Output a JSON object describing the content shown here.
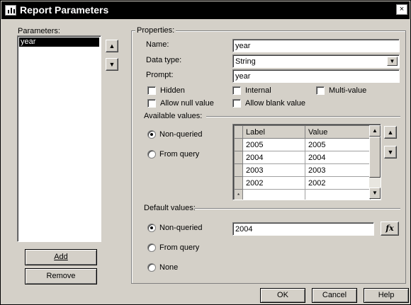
{
  "window": {
    "title": "Report Parameters",
    "close_glyph": "×"
  },
  "parameters_panel": {
    "label": "Parameters:",
    "items": [
      "year"
    ],
    "add_label": "Add",
    "remove_label": "Remove",
    "move_up_glyph": "▲",
    "move_down_glyph": "▼"
  },
  "properties": {
    "group_label": "Properties:",
    "name_label": "Name:",
    "name_value": "year",
    "datatype_label": "Data type:",
    "datatype_value": "String",
    "prompt_label": "Prompt:",
    "prompt_value": "year",
    "checkboxes": {
      "hidden": {
        "label": "Hidden",
        "checked": false
      },
      "internal": {
        "label": "Internal",
        "checked": false
      },
      "multi_value": {
        "label": "Multi-value",
        "checked": false
      },
      "allow_null": {
        "label": "Allow null value",
        "checked": false
      },
      "allow_blank": {
        "label": "Allow blank value",
        "checked": false
      }
    }
  },
  "available_values": {
    "label": "Available values:",
    "options": {
      "non_queried": "Non-queried",
      "from_query": "From query"
    },
    "selected": "non_queried",
    "columns": [
      "Label",
      "Value"
    ],
    "rows": [
      [
        "2005",
        "2005"
      ],
      [
        "2004",
        "2004"
      ],
      [
        "2003",
        "2003"
      ],
      [
        "2002",
        "2002"
      ]
    ],
    "new_row_marker": "*"
  },
  "default_values": {
    "label": "Default values:",
    "options": {
      "non_queried": "Non-queried",
      "from_query": "From query",
      "none": "None"
    },
    "selected": "non_queried",
    "value": "2004",
    "fx_label": "fx"
  },
  "footer": {
    "ok_label": "OK",
    "cancel_label": "Cancel",
    "help_label": "Help"
  },
  "colors": {
    "face": "#d4d0c8",
    "titlebar": "#000000",
    "selection": "#000000"
  }
}
